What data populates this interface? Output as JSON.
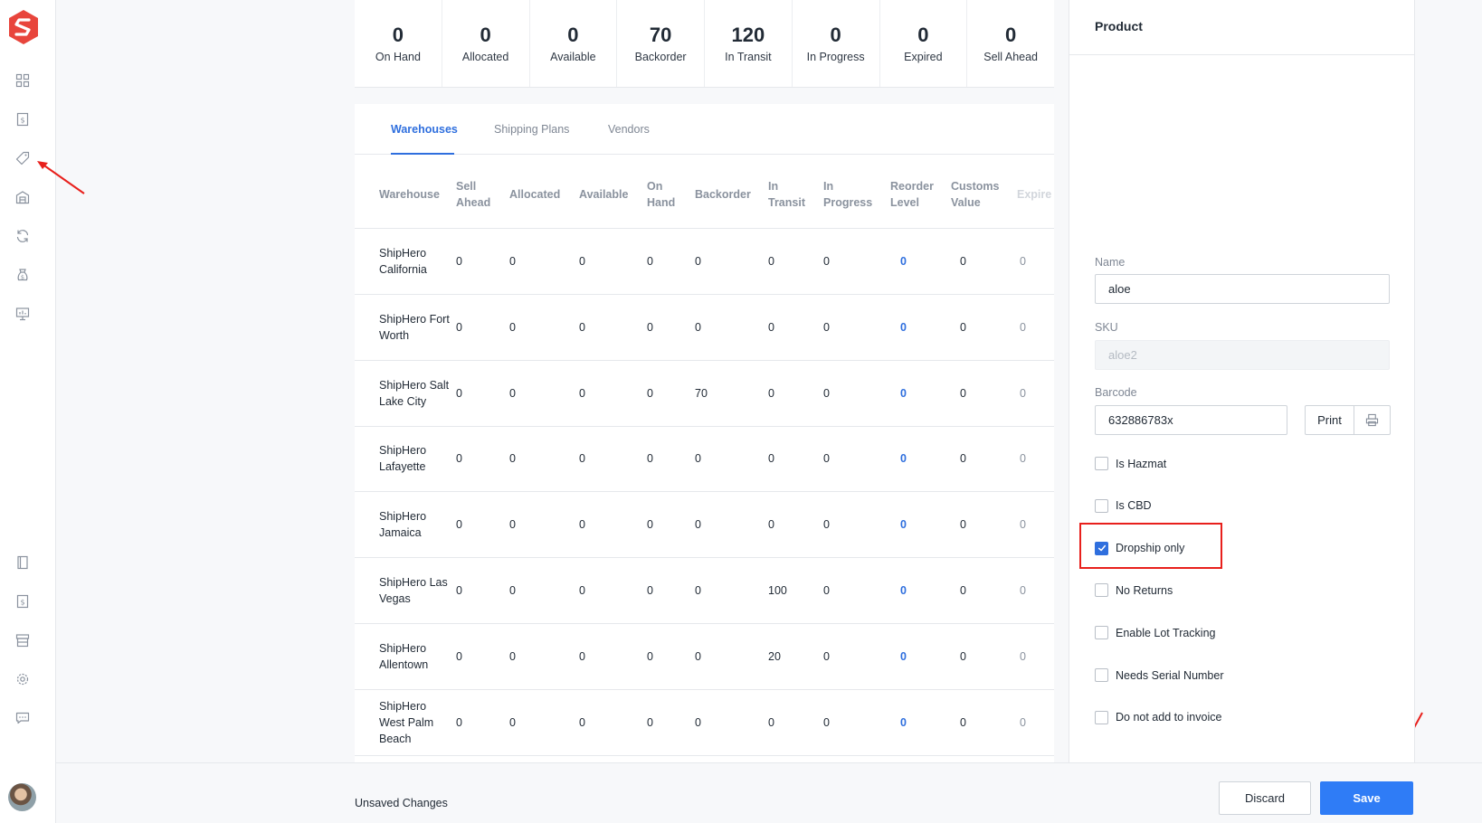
{
  "stats": [
    {
      "value": "0",
      "label": "On Hand"
    },
    {
      "value": "0",
      "label": "Allocated"
    },
    {
      "value": "0",
      "label": "Available"
    },
    {
      "value": "70",
      "label": "Backorder"
    },
    {
      "value": "120",
      "label": "In Transit"
    },
    {
      "value": "0",
      "label": "In Progress"
    },
    {
      "value": "0",
      "label": "Expired"
    },
    {
      "value": "0",
      "label": "Sell Ahead"
    }
  ],
  "tabs": [
    "Warehouses",
    "Shipping Plans",
    "Vendors"
  ],
  "table": {
    "headers": [
      "Warehouse",
      "Sell Ahead",
      "Allocated",
      "Available",
      "On Hand",
      "Backorder",
      "In Transit",
      "In Progress",
      "Reorder Level",
      "Customs Value",
      "Expire"
    ],
    "rows": [
      {
        "warehouse": "ShipHero California",
        "cells": [
          "0",
          "0",
          "0",
          "0",
          "0",
          "0",
          "0",
          "0",
          "0",
          "0"
        ]
      },
      {
        "warehouse": "ShipHero Fort Worth",
        "cells": [
          "0",
          "0",
          "0",
          "0",
          "0",
          "0",
          "0",
          "0",
          "0",
          "0"
        ]
      },
      {
        "warehouse": "ShipHero Salt Lake City",
        "cells": [
          "0",
          "0",
          "0",
          "0",
          "70",
          "0",
          "0",
          "0",
          "0",
          "0"
        ]
      },
      {
        "warehouse": "ShipHero Lafayette",
        "cells": [
          "0",
          "0",
          "0",
          "0",
          "0",
          "0",
          "0",
          "0",
          "0",
          "0"
        ]
      },
      {
        "warehouse": "ShipHero Jamaica",
        "cells": [
          "0",
          "0",
          "0",
          "0",
          "0",
          "0",
          "0",
          "0",
          "0",
          "0"
        ]
      },
      {
        "warehouse": "ShipHero Las Vegas",
        "cells": [
          "0",
          "0",
          "0",
          "0",
          "0",
          "100",
          "0",
          "0",
          "0",
          "0"
        ]
      },
      {
        "warehouse": "ShipHero Allentown",
        "cells": [
          "0",
          "0",
          "0",
          "0",
          "0",
          "20",
          "0",
          "0",
          "0",
          "0"
        ]
      },
      {
        "warehouse": "ShipHero West Palm Beach",
        "cells": [
          "0",
          "0",
          "0",
          "0",
          "0",
          "0",
          "0",
          "0",
          "0",
          "0"
        ]
      }
    ]
  },
  "product": {
    "title": "Product",
    "name_label": "Name",
    "name_value": "aloe",
    "sku_label": "SKU",
    "sku_value": "aloe2",
    "barcode_label": "Barcode",
    "barcode_value": "632886783x",
    "print_label": "Print",
    "checkboxes": [
      {
        "label": "Is Hazmat",
        "checked": false
      },
      {
        "label": "Is CBD",
        "checked": false
      },
      {
        "label": "Dropship only",
        "checked": true
      },
      {
        "label": "No Returns",
        "checked": false
      },
      {
        "label": "Enable Lot Tracking",
        "checked": false
      },
      {
        "label": "Needs Serial Number",
        "checked": false
      },
      {
        "label": "Do not add to invoice",
        "checked": false
      }
    ]
  },
  "footer": {
    "status": "Unsaved Changes",
    "discard_label": "Discard",
    "save_label": "Save"
  },
  "sidebar": {
    "top_icons": [
      "dashboard-icon",
      "orders-icon",
      "products-tag-icon",
      "warehouse-icon",
      "returns-icon",
      "billing-icon",
      "reports-icon"
    ],
    "bottom_icons": [
      "docs-icon",
      "invoice-icon",
      "store-icon",
      "settings-icon",
      "chat-icon"
    ]
  },
  "colors": {
    "accent": "#2f6fde",
    "save_button": "#2f7cf6",
    "brand": "#e8453c",
    "annotation": "#e8201c"
  }
}
